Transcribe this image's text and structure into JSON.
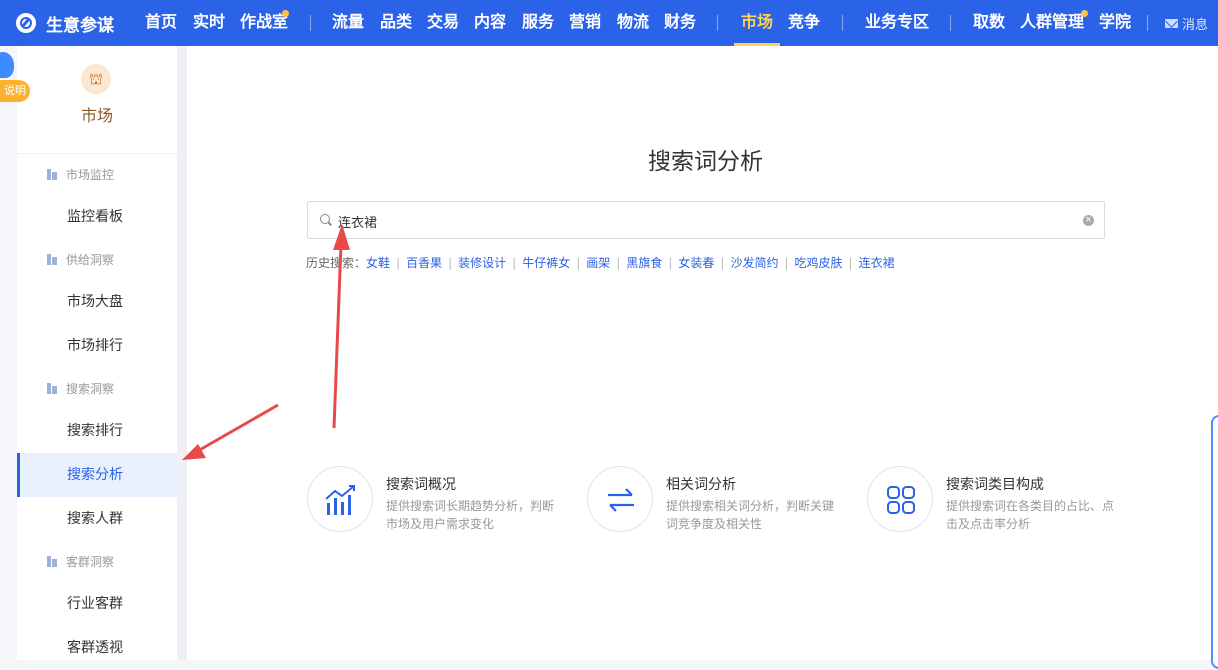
{
  "brand": {
    "name": "生意参谋"
  },
  "nav": {
    "items": [
      "首页",
      "实时",
      "作战室",
      "流量",
      "品类",
      "交易",
      "内容",
      "服务",
      "营销",
      "物流",
      "财务",
      "市场",
      "竞争",
      "业务专区",
      "取数",
      "人群管理",
      "学院"
    ],
    "active": "市场",
    "message": "消息"
  },
  "help_badge": {
    "label": "说明"
  },
  "sidebar": {
    "title": "市场",
    "groups": [
      {
        "label": "市场监控",
        "items": [
          "监控看板"
        ]
      },
      {
        "label": "供给洞察",
        "items": [
          "市场大盘",
          "市场排行"
        ]
      },
      {
        "label": "搜索洞察",
        "items": [
          "搜索排行",
          "搜索分析",
          "搜索人群"
        ]
      },
      {
        "label": "客群洞察",
        "items": [
          "行业客群",
          "客群透视"
        ]
      }
    ],
    "selected": "搜索分析"
  },
  "main": {
    "title": "搜索词分析",
    "search": {
      "value": "连衣裙"
    },
    "history": {
      "label": "历史搜索：",
      "terms": [
        "女鞋",
        "百香果",
        "装修设计",
        "牛仔裤女",
        "画架",
        "黑旗食",
        "女装春",
        "沙发简约",
        "吃鸡皮肤",
        "连衣裙"
      ]
    },
    "features": [
      {
        "title": "搜索词概况",
        "desc": "提供搜索词长期趋势分析，判断市场及用户需求变化",
        "icon": "trend-chart-icon"
      },
      {
        "title": "相关词分析",
        "desc": "提供搜索相关词分析，判断关键词竞争度及相关性",
        "icon": "swap-arrows-icon"
      },
      {
        "title": "搜索词类目构成",
        "desc": "提供搜索词在各类目的占比、点击及点击率分析",
        "icon": "grid-icon"
      }
    ]
  },
  "colors": {
    "nav_bg": "#2a62e8",
    "active_nav": "#ffd34d",
    "accent": "#2a62e8",
    "annotation": "#e84a4a"
  }
}
